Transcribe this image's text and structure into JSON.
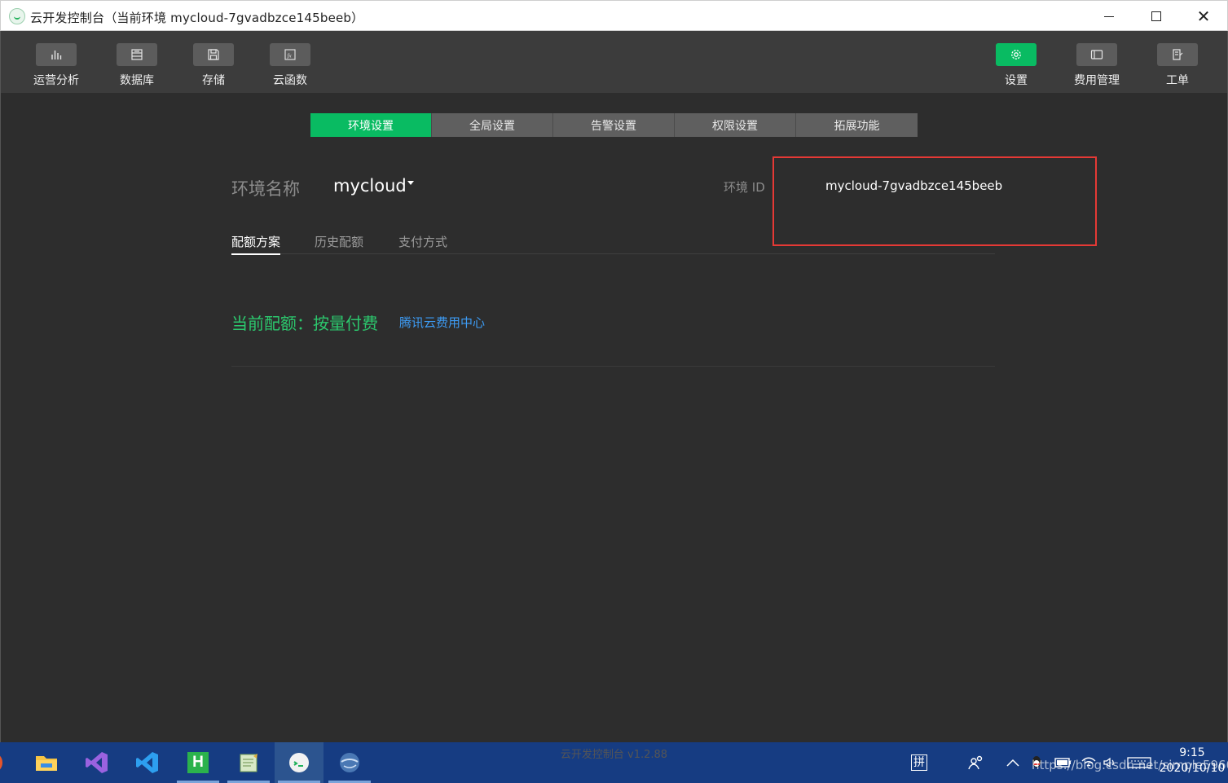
{
  "window": {
    "title": "云开发控制台（当前环境 mycloud-7gvadbzce145beeb）"
  },
  "toolbar": {
    "left": [
      {
        "label": "运营分析",
        "icon": "bar-chart-icon"
      },
      {
        "label": "数据库",
        "icon": "database-icon"
      },
      {
        "label": "存储",
        "icon": "floppy-disk-icon"
      },
      {
        "label": "云函数",
        "icon": "function-icon"
      }
    ],
    "right": [
      {
        "label": "设置",
        "icon": "gear-icon",
        "active": true
      },
      {
        "label": "费用管理",
        "icon": "card-icon"
      },
      {
        "label": "工单",
        "icon": "ticket-icon"
      }
    ]
  },
  "tabs": [
    {
      "label": "环境设置",
      "active": true
    },
    {
      "label": "全局设置"
    },
    {
      "label": "告警设置"
    },
    {
      "label": "权限设置"
    },
    {
      "label": "拓展功能"
    }
  ],
  "environment": {
    "name_label": "环境名称",
    "name_value": "mycloud",
    "id_label": "环境 ID",
    "id_value": "mycloud-7gvadbzce145beeb"
  },
  "subtabs": [
    {
      "label": "配额方案",
      "active": true
    },
    {
      "label": "历史配额"
    },
    {
      "label": "支付方式"
    }
  ],
  "quota": {
    "text": "当前配额：按量付费",
    "link": "腾讯云费用中心"
  },
  "footer": {
    "version": "云开发控制台 v1.2.88"
  },
  "taskbar": {
    "ime": "拼",
    "time": "9:15",
    "date": "2020/10/10",
    "watermark": "https://blog.csdn.net/simple5960"
  },
  "colors": {
    "accent": "#09bb62",
    "link": "#3d9cf5",
    "highlight": "#e53935",
    "background": "#2d2d2d"
  }
}
